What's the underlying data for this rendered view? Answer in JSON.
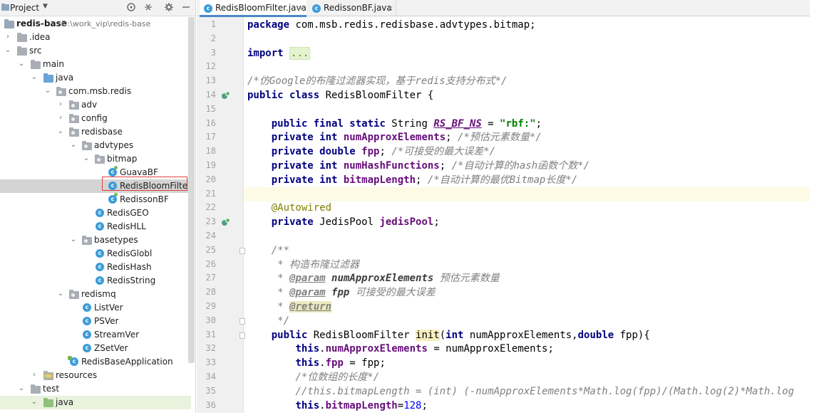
{
  "project_panel": {
    "title": "Project",
    "tree": [
      {
        "label": "redis-base",
        "path": "D:\\work_vip\\redis-base"
      },
      {
        "label": ".idea"
      },
      {
        "label": "src"
      },
      {
        "label": "main"
      },
      {
        "label": "java"
      },
      {
        "label": "com.msb.redis"
      },
      {
        "label": "adv"
      },
      {
        "label": "config"
      },
      {
        "label": "redisbase"
      },
      {
        "label": "advtypes"
      },
      {
        "label": "bitmap"
      },
      {
        "label": "GuavaBF"
      },
      {
        "label": "RedisBloomFilter"
      },
      {
        "label": "RedissonBF"
      },
      {
        "label": "RedisGEO"
      },
      {
        "label": "RedisHLL"
      },
      {
        "label": "basetypes"
      },
      {
        "label": "RedisGlobl"
      },
      {
        "label": "RedisHash"
      },
      {
        "label": "RedisString"
      },
      {
        "label": "redismq"
      },
      {
        "label": "ListVer"
      },
      {
        "label": "PSVer"
      },
      {
        "label": "StreamVer"
      },
      {
        "label": "ZSetVer"
      },
      {
        "label": "RedisBaseApplication"
      },
      {
        "label": "resources"
      },
      {
        "label": "test"
      },
      {
        "label": "java"
      }
    ]
  },
  "tabs": [
    {
      "label": "RedisBloomFilter.java",
      "close": "×",
      "active": true
    },
    {
      "label": "RedissonBF.java",
      "close": "×",
      "active": false
    }
  ],
  "editor": {
    "lines": [
      {
        "n": "1",
        "tokens": [
          [
            "kw",
            "package"
          ],
          [
            "t",
            " com.msb.redis.redisbase.advtypes.bitmap;"
          ]
        ]
      },
      {
        "n": "2",
        "tokens": []
      },
      {
        "n": "3",
        "tokens": [
          [
            "kw",
            "import"
          ],
          [
            "t",
            " "
          ],
          [
            "fold",
            "..."
          ]
        ]
      },
      {
        "n": "12",
        "tokens": []
      },
      {
        "n": "13",
        "tokens": [
          [
            "cmt",
            "/*仿Google的布隆过滤器实现，基于redis支持分布式*/"
          ]
        ]
      },
      {
        "n": "14",
        "tokens": [
          [
            "kw",
            "public class"
          ],
          [
            "t",
            " RedisBloomFilter {"
          ]
        ]
      },
      {
        "n": "15",
        "tokens": []
      },
      {
        "n": "16",
        "tokens": [
          [
            "t",
            "    "
          ],
          [
            "kw",
            "public"
          ],
          [
            "kw",
            " final static"
          ],
          [
            "t",
            " String "
          ],
          [
            "sfield",
            "RS_BF_NS"
          ],
          [
            "t",
            " = "
          ],
          [
            "str",
            "\"rbf:\""
          ],
          [
            "t",
            ";"
          ]
        ]
      },
      {
        "n": "17",
        "tokens": [
          [
            "t",
            "    "
          ],
          [
            "kw",
            "private int"
          ],
          [
            "t",
            " "
          ],
          [
            "field",
            "numApproxElements"
          ],
          [
            "t",
            "; "
          ],
          [
            "cmt",
            "/*预估元素数量*/"
          ]
        ]
      },
      {
        "n": "18",
        "tokens": [
          [
            "t",
            "    "
          ],
          [
            "kw",
            "private double"
          ],
          [
            "t",
            " "
          ],
          [
            "field",
            "fpp"
          ],
          [
            "t",
            "; "
          ],
          [
            "cmt",
            "/*可接受的最大误差*/"
          ]
        ]
      },
      {
        "n": "19",
        "tokens": [
          [
            "t",
            "    "
          ],
          [
            "kw",
            "private int"
          ],
          [
            "t",
            " "
          ],
          [
            "field",
            "numHashFunctions"
          ],
          [
            "t",
            "; "
          ],
          [
            "cmt",
            "/*自动计算的hash函数个数*/"
          ]
        ]
      },
      {
        "n": "20",
        "tokens": [
          [
            "t",
            "    "
          ],
          [
            "kw",
            "private int"
          ],
          [
            "t",
            " "
          ],
          [
            "field",
            "bitmapLength"
          ],
          [
            "t",
            "; "
          ],
          [
            "cmt",
            "/*自动计算的最优Bitmap长度*/"
          ]
        ]
      },
      {
        "n": "21",
        "tokens": []
      },
      {
        "n": "22",
        "tokens": [
          [
            "t",
            "    "
          ],
          [
            "anno",
            "@Autowired"
          ]
        ]
      },
      {
        "n": "23",
        "tokens": [
          [
            "t",
            "    "
          ],
          [
            "kw",
            "private"
          ],
          [
            "t",
            " JedisPool "
          ],
          [
            "field",
            "jedisPool"
          ],
          [
            "t",
            ";"
          ]
        ]
      },
      {
        "n": "24",
        "tokens": []
      },
      {
        "n": "25",
        "tokens": [
          [
            "t",
            "    "
          ],
          [
            "doc",
            "/**"
          ]
        ]
      },
      {
        "n": "26",
        "tokens": [
          [
            "t",
            "     "
          ],
          [
            "doc",
            "* 构造布隆过滤器"
          ]
        ]
      },
      {
        "n": "27",
        "tokens": [
          [
            "t",
            "     "
          ],
          [
            "doc",
            "* "
          ],
          [
            "doctag",
            "@param"
          ],
          [
            "t",
            " "
          ],
          [
            "docparam",
            "numApproxElements"
          ],
          [
            "doc",
            " 预估元素数量"
          ]
        ]
      },
      {
        "n": "28",
        "tokens": [
          [
            "t",
            "     "
          ],
          [
            "doc",
            "* "
          ],
          [
            "doctag",
            "@param"
          ],
          [
            "t",
            " "
          ],
          [
            "docparam",
            "fpp"
          ],
          [
            "doc",
            " 可接受的最大误差"
          ]
        ]
      },
      {
        "n": "29",
        "tokens": [
          [
            "t",
            "     "
          ],
          [
            "doc",
            "* "
          ],
          [
            "doctagm",
            "@return"
          ]
        ]
      },
      {
        "n": "30",
        "tokens": [
          [
            "t",
            "     "
          ],
          [
            "doc",
            "*/"
          ]
        ]
      },
      {
        "n": "31",
        "tokens": [
          [
            "t",
            "    "
          ],
          [
            "kw",
            "public"
          ],
          [
            "t",
            " RedisBloomFilter "
          ],
          [
            "mark2",
            "init"
          ],
          [
            "t",
            "("
          ],
          [
            "kw",
            "int"
          ],
          [
            "t",
            " numApproxElements,"
          ],
          [
            "kw",
            "double"
          ],
          [
            "t",
            " fpp){"
          ]
        ]
      },
      {
        "n": "32",
        "tokens": [
          [
            "t",
            "        "
          ],
          [
            "kw",
            "this"
          ],
          [
            "t",
            "."
          ],
          [
            "field",
            "numApproxElements"
          ],
          [
            "t",
            " = numApproxElements;"
          ]
        ]
      },
      {
        "n": "33",
        "tokens": [
          [
            "t",
            "        "
          ],
          [
            "kw",
            "this"
          ],
          [
            "t",
            "."
          ],
          [
            "field",
            "fpp"
          ],
          [
            "t",
            " = fpp;"
          ]
        ]
      },
      {
        "n": "34",
        "tokens": [
          [
            "t",
            "        "
          ],
          [
            "cmt",
            "/*位数组的长度*/"
          ]
        ]
      },
      {
        "n": "35",
        "tokens": [
          [
            "t",
            "        "
          ],
          [
            "cmt",
            "//this.bitmapLength = (int) (-numApproxElements*Math.log(fpp)/(Math.log(2)*Math.log"
          ]
        ]
      },
      {
        "n": "36",
        "tokens": [
          [
            "t",
            "        "
          ],
          [
            "kw",
            "this"
          ],
          [
            "t",
            "."
          ],
          [
            "field",
            "bitmapLength"
          ],
          [
            "t",
            "="
          ],
          [
            "num",
            "128"
          ],
          [
            "t",
            ";"
          ]
        ]
      }
    ]
  },
  "colors": {
    "keyword": "#000080",
    "string": "#008000",
    "number": "#0000ff",
    "comment": "#808080",
    "field": "#660e7a",
    "annotation": "#808000",
    "selection_border": "#e0403d",
    "active_tab_underline": "#4a88c7"
  },
  "icons": [
    "project-icon",
    "settings-icon",
    "collapse-icon",
    "gear-icon",
    "minimize-icon",
    "class-icon",
    "package-folder-icon",
    "spring-bean-icon"
  ]
}
